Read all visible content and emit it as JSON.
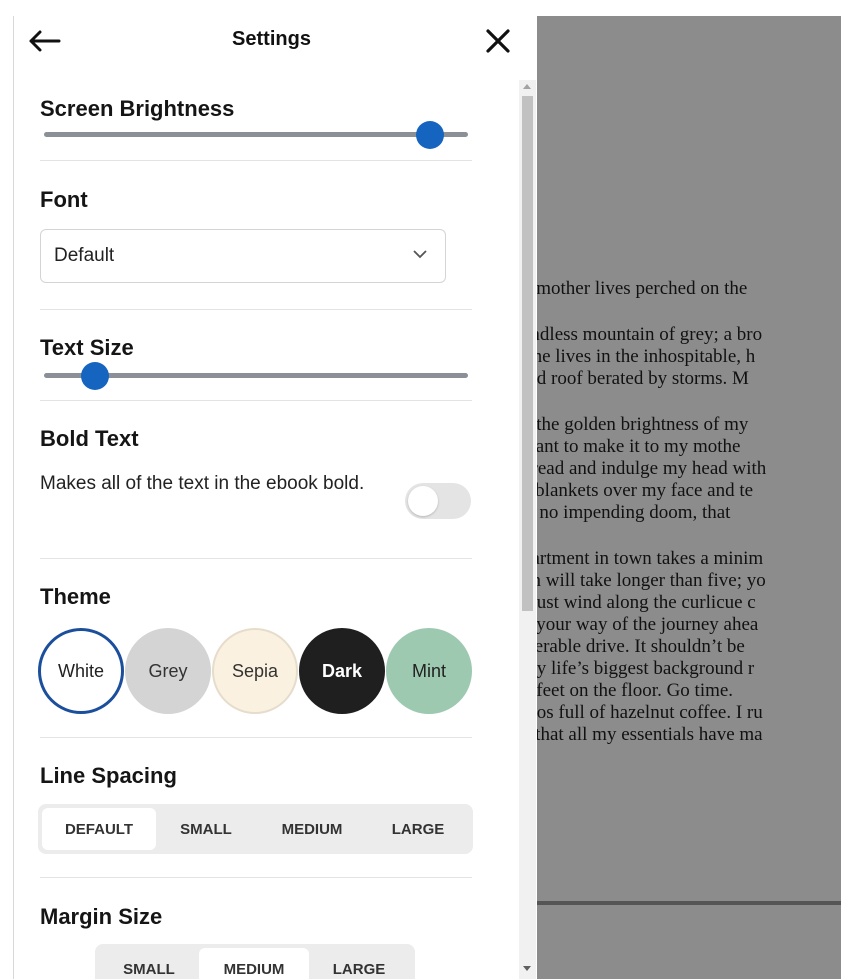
{
  "header": {
    "title": "Settings",
    "back_icon": "arrow-left-icon",
    "close_icon": "close-icon"
  },
  "brightness": {
    "label": "Screen Brightness",
    "value_fraction": 0.91
  },
  "font": {
    "label": "Font",
    "selected": "Default"
  },
  "text_size": {
    "label": "Text Size",
    "value_fraction": 0.12
  },
  "bold_text": {
    "label": "Bold Text",
    "description": "Makes all of the text in the ebook bold.",
    "enabled": false
  },
  "theme": {
    "label": "Theme",
    "options": [
      {
        "label": "White",
        "bg": "#ffffff",
        "fg": "#222222",
        "border": "#1b4f9c",
        "selected": true
      },
      {
        "label": "Grey",
        "bg": "#d4d4d4",
        "fg": "#333333",
        "border": "#d4d4d4"
      },
      {
        "label": "Sepia",
        "bg": "#fbf1e0",
        "fg": "#333333",
        "border": "#e6dccb"
      },
      {
        "label": "Dark",
        "bg": "#1f1f1f",
        "fg": "#ffffff",
        "border": "#1f1f1f"
      },
      {
        "label": "Mint",
        "bg": "#9dc9b1",
        "fg": "#222222",
        "border": "#9dc9b1"
      }
    ]
  },
  "line_spacing": {
    "label": "Line Spacing",
    "options": [
      "DEFAULT",
      "SMALL",
      "MEDIUM",
      "LARGE"
    ],
    "selected": "DEFAULT"
  },
  "margin_size": {
    "label": "Margin Size",
    "options": [
      "SMALL",
      "MEDIUM",
      "LARGE"
    ],
    "selected": "MEDIUM"
  },
  "book": {
    "paragraphs": [
      [
        "y mother lives perched on the"
      ],
      [
        "endless mountain of grey; a bro",
        "She lives in the inhospitable, h",
        "red roof berated by storms. M"
      ],
      [
        "o the golden brightness of my",
        " want to make it to my mothe",
        "dread and indulge my head with",
        "e blankets over my face and te",
        " is no impending doom, that"
      ],
      [
        "partment in town takes a minim",
        "on will take longer than five; yo",
        "must wind along the curlicue c",
        "n your way of the journey ahea",
        "iserable drive. It shouldn’t be",
        "my life’s biggest background r",
        "y feet on the floor. Go time.",
        "mos full of hazelnut coffee. I ru",
        "e that all my essentials have ma"
      ]
    ]
  },
  "colors": {
    "accent": "#1565c0",
    "reader_bg": "#8c8c8c"
  }
}
